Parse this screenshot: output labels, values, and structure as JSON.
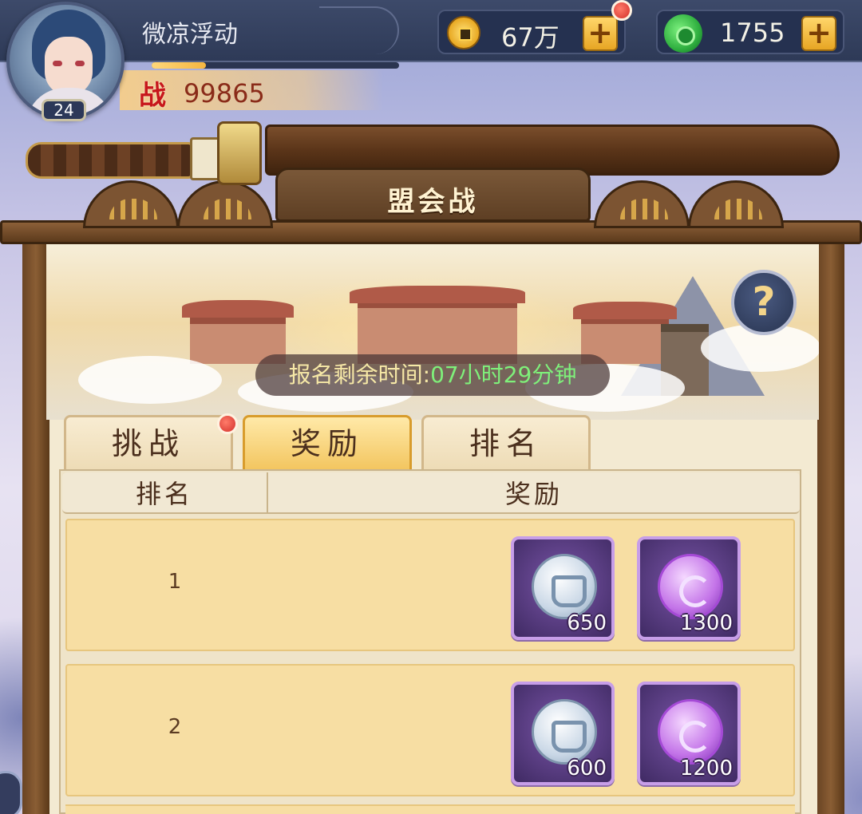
{
  "player": {
    "name": "微凉浮动",
    "level": "24",
    "power_label": "战",
    "power_value": "99865",
    "exp_fraction": 0.22
  },
  "currencies": [
    {
      "icon": "copper-coin-icon",
      "value": "67万"
    },
    {
      "icon": "jade-icon",
      "value": "1755"
    }
  ],
  "buttons": {
    "add_label": "+",
    "help_label": "?"
  },
  "page": {
    "title": "盟会战",
    "signup_label": "报名剩余时间:",
    "signup_value": "07小时29分钟"
  },
  "tabs": [
    {
      "label": "挑战",
      "active": false,
      "has_notice": true
    },
    {
      "label": "奖励",
      "active": true,
      "has_notice": false
    },
    {
      "label": "排名",
      "active": false,
      "has_notice": false
    }
  ],
  "table": {
    "headers": {
      "rank": "排名",
      "reward": "奖励"
    },
    "rows": [
      {
        "rank": "1",
        "items": [
          {
            "icon": "silver-token-icon",
            "count": "650"
          },
          {
            "icon": "purple-token-icon",
            "count": "1300"
          }
        ]
      },
      {
        "rank": "2",
        "items": [
          {
            "icon": "silver-token-icon",
            "count": "600"
          },
          {
            "icon": "purple-token-icon",
            "count": "1200"
          }
        ]
      }
    ]
  },
  "colors": {
    "timer_label": "#f6e8a6",
    "timer_value": "#7ff07a",
    "power_red": "#c7171c",
    "row_bg": "#f7dea3",
    "item_bg": "#5a3d86"
  }
}
